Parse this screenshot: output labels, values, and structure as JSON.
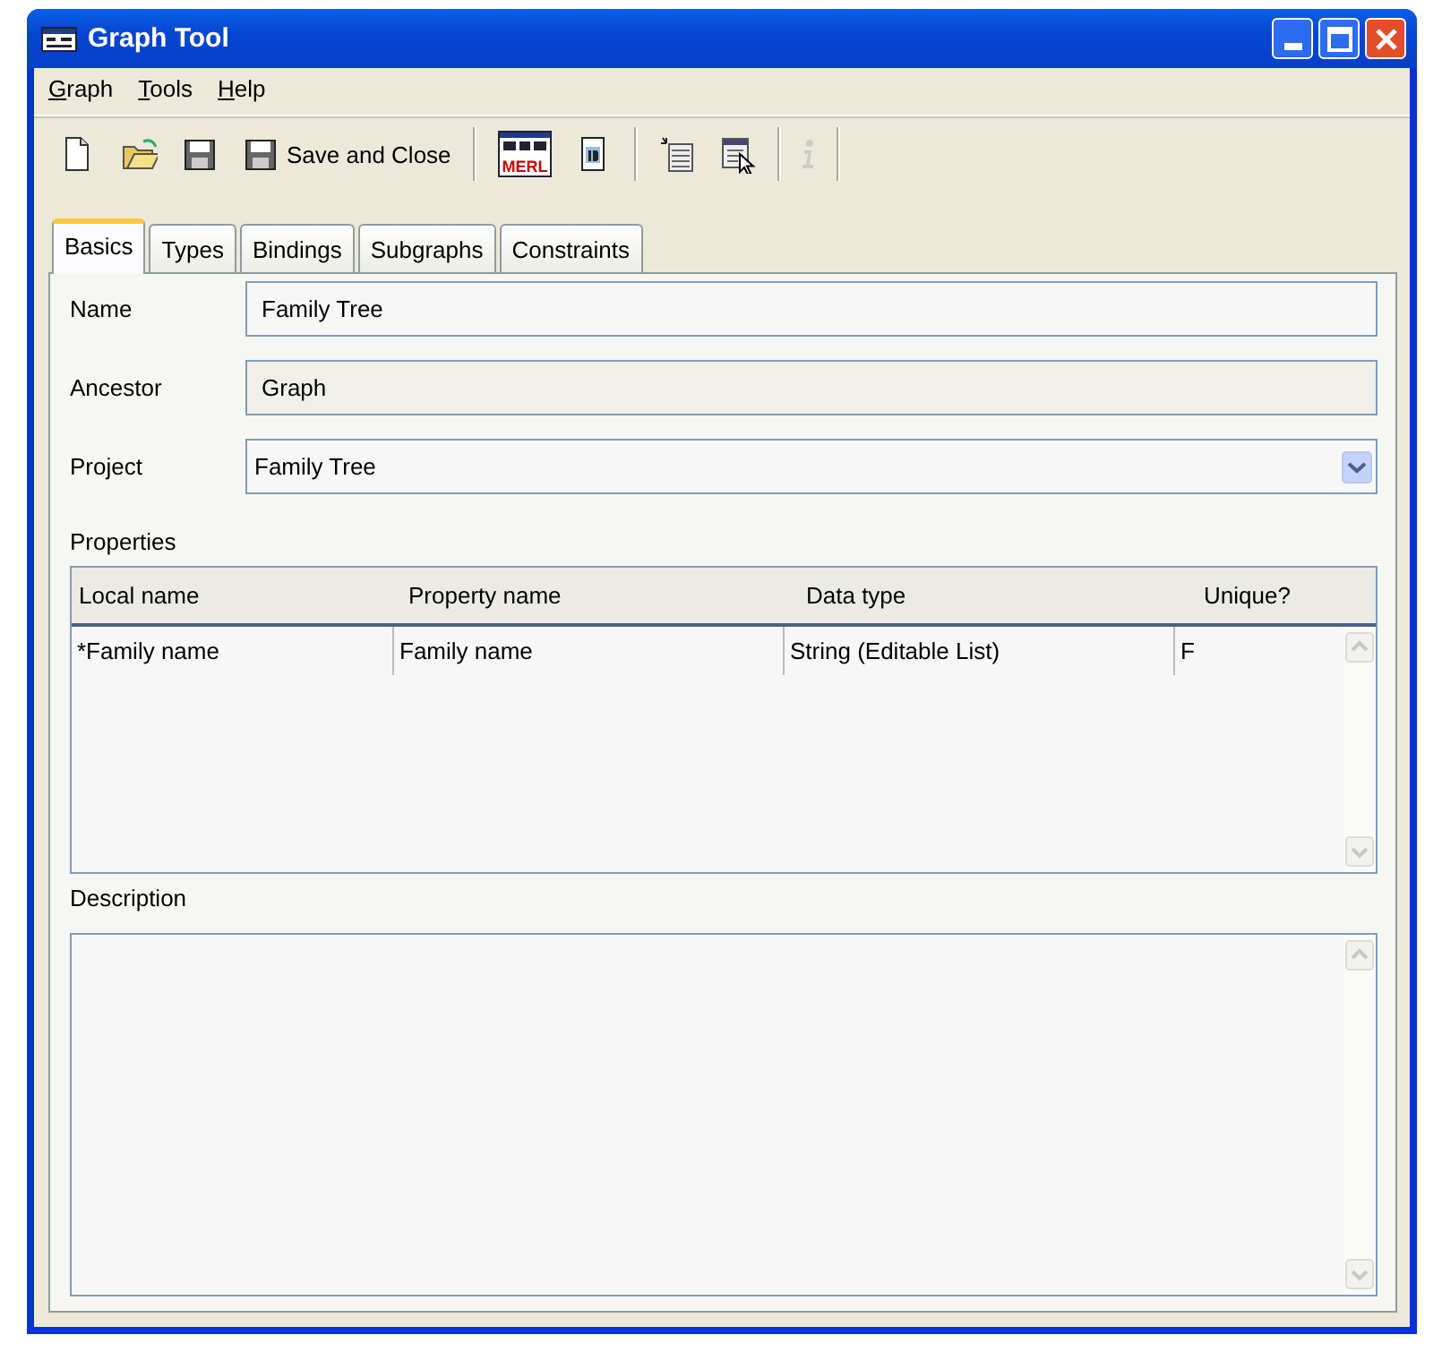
{
  "window": {
    "title": "Graph Tool"
  },
  "menu": [
    "Graph",
    "Tools",
    "Help"
  ],
  "toolbar": [
    {
      "kind": "button",
      "disabled": false
    },
    {
      "kind": "button",
      "disabled": false
    },
    {
      "kind": "button",
      "disabled": false
    },
    {
      "kind": "button",
      "disabled": false,
      "label": "Save and Close"
    },
    {
      "kind": "separator"
    },
    {
      "kind": "button",
      "disabled": false,
      "badge": "MERL"
    },
    {
      "kind": "button",
      "disabled": false
    },
    {
      "kind": "separator"
    },
    {
      "kind": "button",
      "disabled": false
    },
    {
      "kind": "button",
      "disabled": false
    },
    {
      "kind": "separator"
    },
    {
      "kind": "button",
      "disabled": true
    },
    {
      "kind": "separator"
    }
  ],
  "tabs": [
    {
      "label": "Basics",
      "selected": true
    },
    {
      "label": "Types",
      "selected": false
    },
    {
      "label": "Bindings",
      "selected": false
    },
    {
      "label": "Subgraphs",
      "selected": false
    },
    {
      "label": "Constraints",
      "selected": false
    }
  ],
  "fields": [
    {
      "label": "Name",
      "kind": "text",
      "value": "Family Tree",
      "disabled": false
    },
    {
      "label": "Ancestor",
      "kind": "text",
      "value": "Graph",
      "disabled": true
    },
    {
      "label": "Project",
      "kind": "dropdown",
      "value": "Family Tree",
      "disabled": false
    }
  ],
  "properties": {
    "label": "Properties",
    "columns": [
      "Local name",
      "Property name",
      "Data type",
      "Unique?"
    ],
    "rows": [
      [
        "*Family name",
        "Family name",
        "String (Editable List)",
        "F"
      ]
    ]
  },
  "description": {
    "label": "Description"
  }
}
